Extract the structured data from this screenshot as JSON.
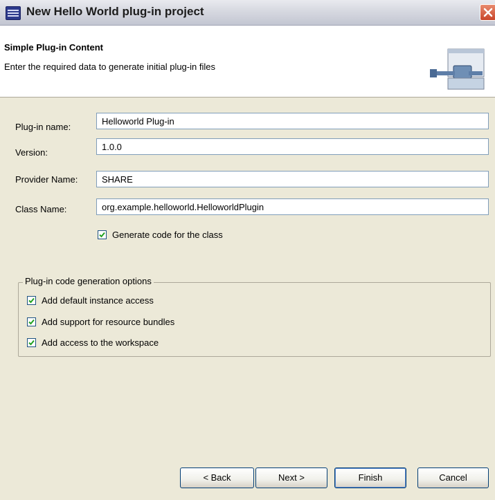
{
  "window": {
    "title": "New Hello World plug-in project"
  },
  "banner": {
    "title": "Simple Plug-in Content",
    "description": "Enter the required data to generate initial plug-in files",
    "icon": "plugin-wizard-icon"
  },
  "form": {
    "plugin_name": {
      "label": "Plug-in name:",
      "value": "Helloworld Plug-in"
    },
    "version": {
      "label": "Version:",
      "value": "1.0.0"
    },
    "provider_name": {
      "label": "Provider Name:",
      "value": "SHARE"
    },
    "class_name": {
      "label": "Class Name:",
      "value": "org.example.helloworld.HelloworldPlugin"
    },
    "generate_code": {
      "label": "Generate code for the class",
      "checked": true
    }
  },
  "options_group": {
    "title": "Plug-in code generation options",
    "options": [
      {
        "label": "Add default instance access",
        "checked": true
      },
      {
        "label": "Add support for resource bundles",
        "checked": true
      },
      {
        "label": "Add access to the workspace",
        "checked": true
      }
    ]
  },
  "buttons": {
    "back": "< Back",
    "next": "Next >",
    "finish": "Finish",
    "cancel": "Cancel"
  },
  "colors": {
    "dialog_background": "#ece9d8",
    "banner_background": "#ffffff",
    "field_border": "#7f9db9",
    "close_button": "#c9452a"
  }
}
